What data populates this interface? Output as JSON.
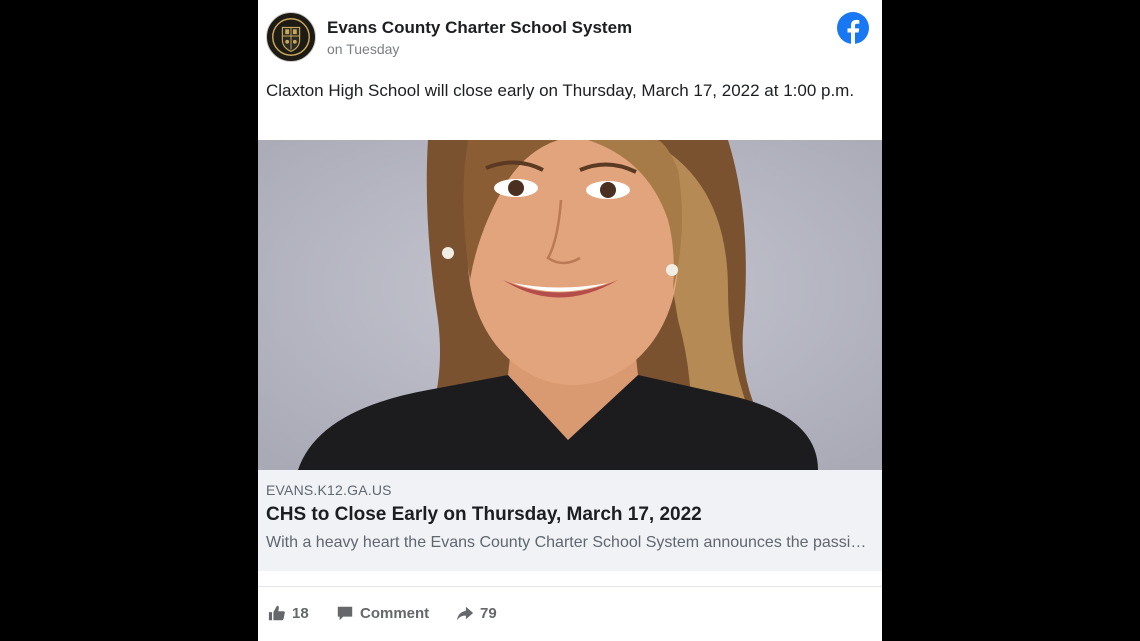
{
  "post": {
    "page_name": "Evans County Charter School System",
    "time": "on Tuesday",
    "text": "Claxton High School will close early on Thursday, March 17, 2022 at 1:00 p.m.",
    "platform_icon": "facebook-icon",
    "avatar_icon": "school-crest-icon"
  },
  "link_preview": {
    "domain": "EVANS.K12.GA.US",
    "title": "CHS to Close Early on Thursday, March 17, 2022",
    "description": "With a heavy heart the Evans County Charter School System announces the passing of …"
  },
  "actions": {
    "likes": "18",
    "comment_label": "Comment",
    "shares": "79"
  },
  "colors": {
    "facebook_blue": "#1877f2",
    "background": "#000000",
    "preview_bg": "#f0f2f5"
  }
}
